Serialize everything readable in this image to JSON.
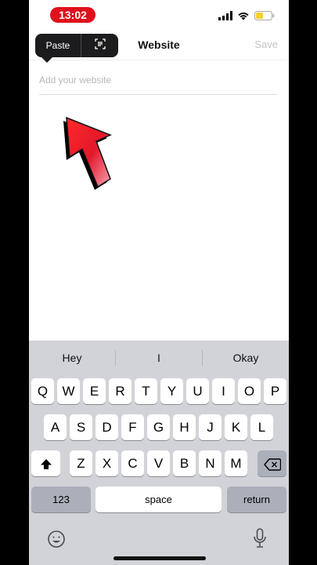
{
  "status_bar": {
    "time": "13:02",
    "time_pill_color": "#e0101c",
    "icons": [
      "cellular-signal-icon",
      "wifi-icon",
      "battery-icon"
    ]
  },
  "header": {
    "title": "Website",
    "save_label": "Save"
  },
  "edit_menu": {
    "paste_label": "Paste",
    "scan_icon": "scan-text-icon"
  },
  "website_input": {
    "placeholder": "Add your website",
    "value": ""
  },
  "overlay": {
    "arrow_icon": "red-arrow-pointer-icon",
    "arrow_color": "#e3182b"
  },
  "keyboard": {
    "suggestions": [
      "Hey",
      "I",
      "Okay"
    ],
    "row1": [
      "Q",
      "W",
      "E",
      "R",
      "T",
      "Y",
      "U",
      "I",
      "O",
      "P"
    ],
    "row2": [
      "A",
      "S",
      "D",
      "F",
      "G",
      "H",
      "J",
      "K",
      "L"
    ],
    "row3": [
      "Z",
      "X",
      "C",
      "V",
      "B",
      "N",
      "M"
    ],
    "numbers_label": "123",
    "space_label": "space",
    "return_label": "return",
    "shift_icon": "shift-icon",
    "backspace_icon": "backspace-icon",
    "emoji_icon": "emoji-icon",
    "mic_icon": "microphone-icon"
  }
}
